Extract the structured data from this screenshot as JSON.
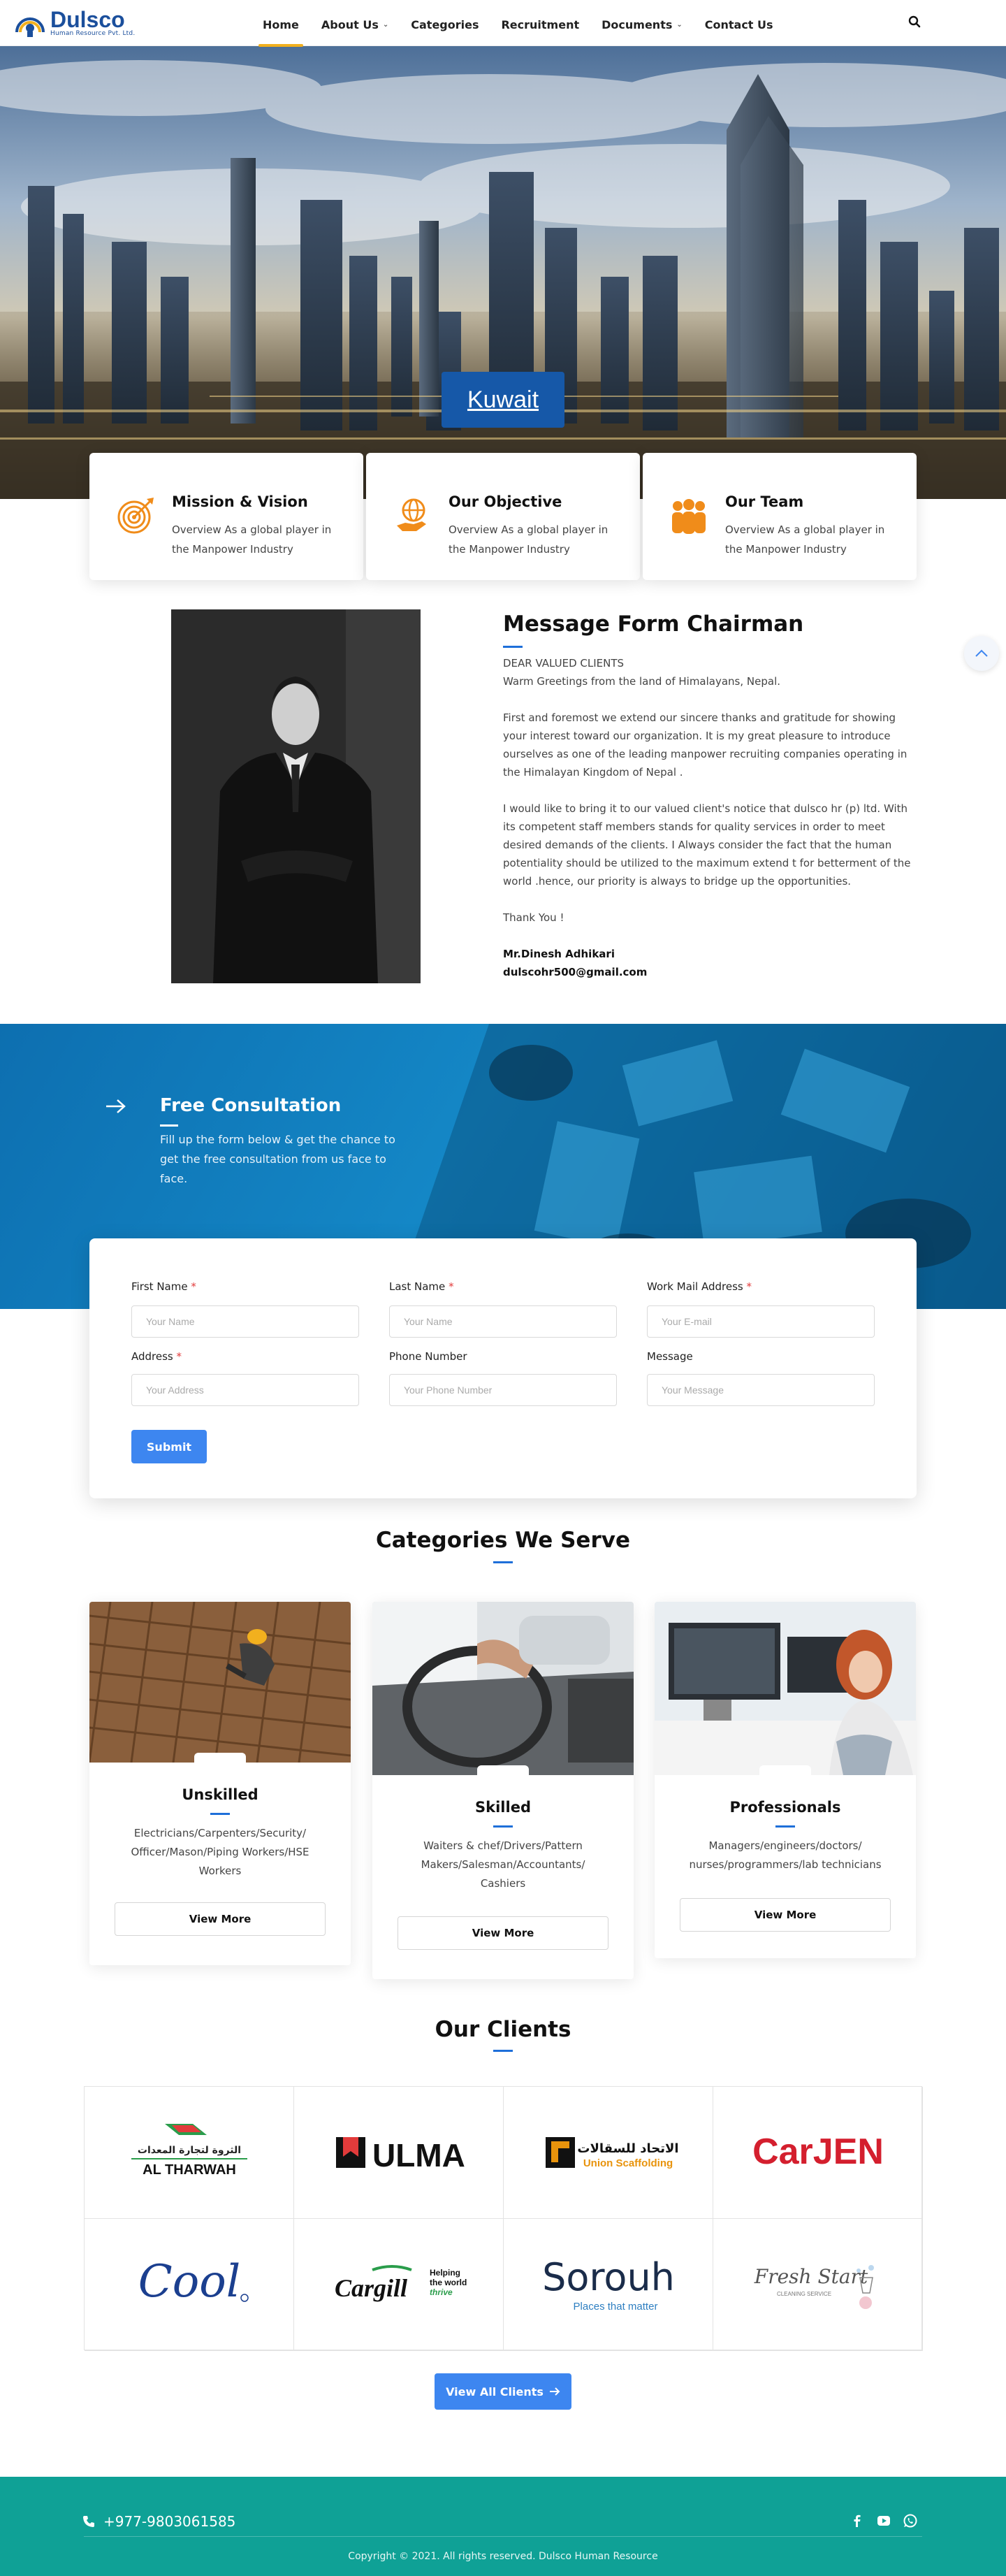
{
  "brand": {
    "name": "Dulsco",
    "tagline": "Human Resource Pvt. Ltd."
  },
  "nav": [
    {
      "label": "Home",
      "active": true,
      "dropdown": false
    },
    {
      "label": "About Us",
      "active": false,
      "dropdown": true
    },
    {
      "label": "Categories",
      "active": false,
      "dropdown": false
    },
    {
      "label": "Recruitment",
      "active": false,
      "dropdown": false
    },
    {
      "label": "Documents",
      "active": false,
      "dropdown": true
    },
    {
      "label": "Contact Us",
      "active": false,
      "dropdown": false
    }
  ],
  "hero": {
    "button": "Kuwait"
  },
  "features": [
    {
      "title": "Mission & Vision",
      "text": "Overview As a global player in the Manpower Industry",
      "icon": "target-icon"
    },
    {
      "title": "Our Objective",
      "text": "Overview As a global player in the Manpower Industry",
      "icon": "globe-hand-icon"
    },
    {
      "title": "Our Team",
      "text": "Overview As a global player in the Manpower Industry",
      "icon": "team-icon"
    }
  ],
  "chairman": {
    "title": "Message Form Chairman",
    "salutation": "DEAR VALUED CLIENTS",
    "greeting": "Warm Greetings from the land of Himalayans, Nepal.",
    "p1": "First and foremost we extend our sincere thanks and gratitude for showing your interest toward our organization. It is my great pleasure to introduce ourselves as one of the leading manpower recruiting companies operating in the Himalayan Kingdom of Nepal .",
    "p2": "I would like to bring it to our valued client's notice that dulsco hr (p) ltd. With its competent staff members stands for quality services in order to meet desired demands of the clients. I Always consider the fact that the human potentiality should be utilized to the maximum extend t for betterment of the world .hence, our priority is always to bridge up the opportunities.",
    "thanks": "Thank You !",
    "name": "Mr.Dinesh Adhikari",
    "email": "dulscohr500@gmail.com"
  },
  "consult": {
    "title": "Free Consultation",
    "subtitle": "Fill up the form below & get the chance to get the free consultation from us face to face."
  },
  "form": {
    "first_name": {
      "label": "First Name",
      "placeholder": "Your Name"
    },
    "last_name": {
      "label": "Last Name",
      "placeholder": "Your Name"
    },
    "work_mail": {
      "label": "Work Mail Address",
      "placeholder": "Your E-mail"
    },
    "address": {
      "label": "Address",
      "placeholder": "Your Address"
    },
    "phone": {
      "label": "Phone Number",
      "placeholder": "Your Phone Number"
    },
    "message": {
      "label": "Message",
      "placeholder": "Your Message"
    },
    "submit": "Submit",
    "required_mark": "*"
  },
  "categories": {
    "title": "Categories We Serve",
    "items": [
      {
        "title": "Unskilled",
        "desc": "Electricians/Carpenters/Security/ Officer/Mason/Piping Workers/HSE Workers",
        "button": "View More"
      },
      {
        "title": "Skilled",
        "desc": "Waiters & chef/Drivers/Pattern Makers/Salesman/Accountants/ Cashiers",
        "button": "View More"
      },
      {
        "title": "Professionals",
        "desc": "Managers/engineers/doctors/ nurses/programmers/lab technicians",
        "button": "View More"
      }
    ]
  },
  "clients": {
    "title": "Our Clients",
    "logos": [
      "Al Tharwah",
      "ULMA",
      "Union Scaffolding",
      "CarJEN",
      "Cool",
      "Cargill",
      "Sorouh",
      "Fresh Start"
    ],
    "logo_text": {
      "altharwah_ar": "الثروة لتجارة المعدات",
      "altharwah": "AL THARWAH",
      "ulma": "ULMA",
      "union_ar": "الاتحاد للسقالات",
      "union": "Union Scaffolding",
      "carjen": "CarJEN",
      "cool": "Cool",
      "cargill": "Cargill",
      "cargill_tag1": "Helping",
      "cargill_tag2": "the world",
      "cargill_tag3": "thrive",
      "sorouh": "Sorouh",
      "sorouh_tag": "Places that matter",
      "fresh": "Fresh Start",
      "fresh_tag": "CLEANING SERVICE"
    },
    "button": "View All Clients"
  },
  "footer": {
    "phone": "+977-9803061585",
    "copyright": "Copyright © 2021. All rights reserved. Dulsco Human Resource"
  },
  "colors": {
    "brand_blue": "#1b4f9c",
    "accent_blue": "#3d86f0",
    "nav_accent": "#f2b01e",
    "footer_teal": "#0fa196",
    "icon_orange": "#f08c1a"
  }
}
